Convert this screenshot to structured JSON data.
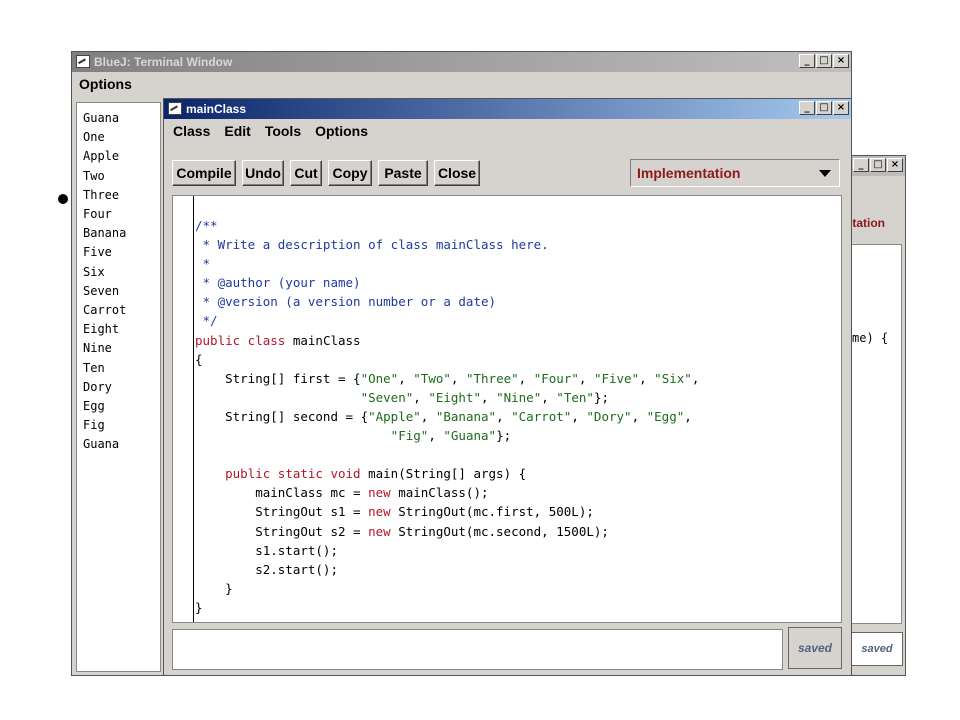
{
  "terminal_window": {
    "title": "BlueJ:  Terminal Window",
    "menu": [
      "Options"
    ],
    "output_lines": [
      "Guana",
      "One",
      "Apple",
      "Two",
      "Three",
      "Four",
      "Banana",
      "Five",
      "Six",
      "Seven",
      "Carrot",
      "Eight",
      "Nine",
      "Ten",
      "Dory",
      "Egg",
      "Fig",
      "Guana"
    ]
  },
  "back_editor": {
    "view_label_partial": "ntation",
    "code_fragment": "me) {",
    "status": "saved"
  },
  "editor_window": {
    "title": "mainClass",
    "menu": [
      "Class",
      "Edit",
      "Tools",
      "Options"
    ],
    "toolbar": [
      "Compile",
      "Undo",
      "Cut",
      "Copy",
      "Paste",
      "Close"
    ],
    "view_select": "Implementation",
    "status": "saved",
    "code_lines": [
      [
        [
          "c",
          "/**"
        ]
      ],
      [
        [
          "c",
          " * Write a description of class mainClass here."
        ]
      ],
      [
        [
          "c",
          " *"
        ]
      ],
      [
        [
          "c",
          " * @author (your name)"
        ]
      ],
      [
        [
          "c",
          " * @version (a version number or a date)"
        ]
      ],
      [
        [
          "c",
          " */"
        ]
      ],
      [
        [
          "k",
          "public class"
        ],
        [
          "t",
          " mainClass"
        ]
      ],
      [
        [
          "t",
          "{"
        ]
      ],
      [
        [
          "t",
          "    String[] first = {"
        ],
        [
          "s",
          "\"One\""
        ],
        [
          "t",
          ", "
        ],
        [
          "s",
          "\"Two\""
        ],
        [
          "t",
          ", "
        ],
        [
          "s",
          "\"Three\""
        ],
        [
          "t",
          ", "
        ],
        [
          "s",
          "\"Four\""
        ],
        [
          "t",
          ", "
        ],
        [
          "s",
          "\"Five\""
        ],
        [
          "t",
          ", "
        ],
        [
          "s",
          "\"Six\""
        ],
        [
          "t",
          ","
        ]
      ],
      [
        [
          "t",
          "                      "
        ],
        [
          "s",
          "\"Seven\""
        ],
        [
          "t",
          ", "
        ],
        [
          "s",
          "\"Eight\""
        ],
        [
          "t",
          ", "
        ],
        [
          "s",
          "\"Nine\""
        ],
        [
          "t",
          ", "
        ],
        [
          "s",
          "\"Ten\""
        ],
        [
          "t",
          "};"
        ]
      ],
      [
        [
          "t",
          "    String[] second = {"
        ],
        [
          "s",
          "\"Apple\""
        ],
        [
          "t",
          ", "
        ],
        [
          "s",
          "\"Banana\""
        ],
        [
          "t",
          ", "
        ],
        [
          "s",
          "\"Carrot\""
        ],
        [
          "t",
          ", "
        ],
        [
          "s",
          "\"Dory\""
        ],
        [
          "t",
          ", "
        ],
        [
          "s",
          "\"Egg\""
        ],
        [
          "t",
          ","
        ]
      ],
      [
        [
          "t",
          "                          "
        ],
        [
          "s",
          "\"Fig\""
        ],
        [
          "t",
          ", "
        ],
        [
          "s",
          "\"Guana\""
        ],
        [
          "t",
          "};"
        ]
      ],
      [
        [
          "t",
          ""
        ]
      ],
      [
        [
          "t",
          "    "
        ],
        [
          "k",
          "public static void"
        ],
        [
          "t",
          " main(String[] args) {"
        ]
      ],
      [
        [
          "t",
          "        mainClass mc = "
        ],
        [
          "k",
          "new"
        ],
        [
          "t",
          " mainClass();"
        ]
      ],
      [
        [
          "t",
          "        StringOut s1 = "
        ],
        [
          "k",
          "new"
        ],
        [
          "t",
          " StringOut(mc.first, 500L);"
        ]
      ],
      [
        [
          "t",
          "        StringOut s2 = "
        ],
        [
          "k",
          "new"
        ],
        [
          "t",
          " StringOut(mc.second, 1500L);"
        ]
      ],
      [
        [
          "t",
          "        s1.start();"
        ]
      ],
      [
        [
          "t",
          "        s2.start();"
        ]
      ],
      [
        [
          "t",
          "    }"
        ]
      ],
      [
        [
          "t",
          "}"
        ]
      ]
    ]
  },
  "window_controls": {
    "minimize": "_",
    "maximize": "□",
    "close": "×"
  }
}
